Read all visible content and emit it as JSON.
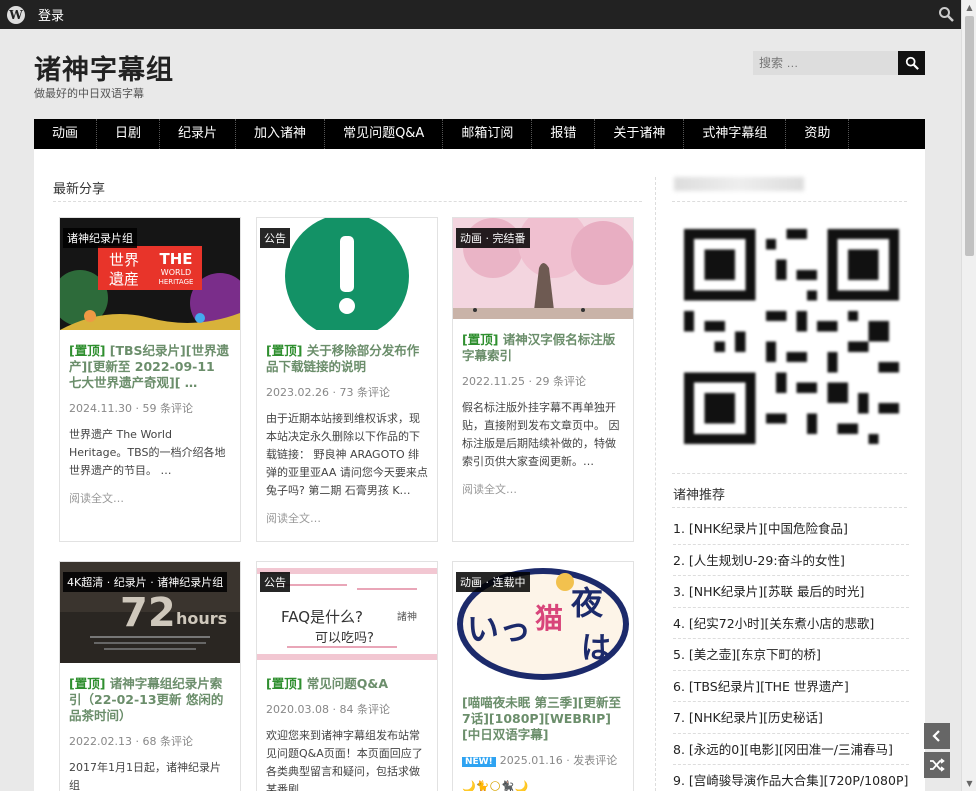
{
  "adminbar": {
    "logo_letter": "W",
    "login": "登录"
  },
  "site": {
    "title": "诸神字幕组",
    "description": "做最好的中日双语字幕"
  },
  "search": {
    "placeholder": "搜索 …"
  },
  "nav": [
    "动画",
    "日剧",
    "纪录片",
    "加入诸神",
    "常见问题Q&A",
    "邮箱订阅",
    "报错",
    "关于诸神",
    "式神字幕组",
    "资助"
  ],
  "section": {
    "title": "最新分享"
  },
  "cards": [
    {
      "badge": "诸神纪录片组",
      "pin": "[置顶]",
      "title": " [TBS纪录片][世界遗产][更新至 2022-09-11 七大世界遗产奇观][ …",
      "meta": "2024.11.30 · 59 条评论",
      "excerpt": "世界遗产 The World Heritage。TBS的一档介绍各地世界遗产的节目。 …",
      "read_more": "阅读全文…",
      "img_text": {
        "left": "世界\n遺産",
        "right": "THE\nWORLD\nHERITAGE"
      }
    },
    {
      "badge": "公告",
      "pin": "[置顶]",
      "title": " 关于移除部分发布作品下载链接的说明",
      "meta": "2023.02.26 · 73 条评论",
      "excerpt": "由于近期本站接到维权诉求，现本站决定永久删除以下作品的下载链接：  野良神 ARAGOTO 绯弹的亚里亚AA 请问您今天要来点兔子吗? 第二期 石膏男孩 K…",
      "read_more": "阅读全文…",
      "img_text": {
        "mark": "!"
      }
    },
    {
      "badge": "动画 · 完结番",
      "pin": "[置顶]",
      "title": " 诸神汉字假名标注版字幕索引",
      "meta": "2022.11.25 · 29 条评论",
      "excerpt": "假名标注版外挂字幕不再单独开贴，直接附到发布文章页中。 因标注版是后期陆续补做的，特做索引页供大家查阅更新。…",
      "read_more": "阅读全文…"
    },
    {
      "badge": "4K超清 · 纪录片 · 诸神纪录片组",
      "pin": "[置顶]",
      "title": " 诸神字幕组纪录片索引（22-02-13更新 悠闲的品茶时间）",
      "meta": "2022.02.13 · 68 条评论",
      "excerpt": "2017年1月1日起，诸神纪录片组",
      "img_text": {
        "big": "72",
        "small": "hours"
      }
    },
    {
      "badge": "公告",
      "pin": "[置顶]",
      "title": " 常见问题Q&A",
      "meta": "2020.03.08 · 84 条评论",
      "excerpt": "欢迎您来到诸神字幕组发布站常见问题Q&A页面！本页面回应了各类典型留言和疑问，包括求做某番剧",
      "img_text": {
        "line1": "FAQ是什么?",
        "line2": "可以吃吗?"
      }
    },
    {
      "badge": "动画 · 连载中",
      "title": "[喵喵夜未眠 第三季][更新至7话][1080P][WEBRIP][中日双语字幕]",
      "new_label": "NEW!",
      "meta": "2025.01.16 · 发表评论",
      "img_text": {
        "a": "夜",
        "b": "は",
        "c": "猫"
      }
    }
  ],
  "sidebar": {
    "recommend_title": "诸神推荐",
    "recommend": [
      "1. [NHK纪录片][中国危险食品]",
      "2. [人生规划U-29:奋斗的女性]",
      "3. [NHK纪录片][苏联 最后的时光]",
      "4. [纪实72小时][关东煮小店的悲歌]",
      "5. [美之壶][东京下町的桥]",
      "6. [TBS纪录片][THE 世界遗产]",
      "7. [NHK纪录片][历史秘话]",
      "8. [永远的0][电影][冈田准一/三浦春马]",
      "9. [宫崎骏导演作品大合集][720P/1080P]"
    ]
  },
  "colors": {
    "nav_bg": "#000000",
    "pin_green": "#2f8f2f",
    "link_green": "#6b8e6b",
    "adminbar": "#222222"
  }
}
